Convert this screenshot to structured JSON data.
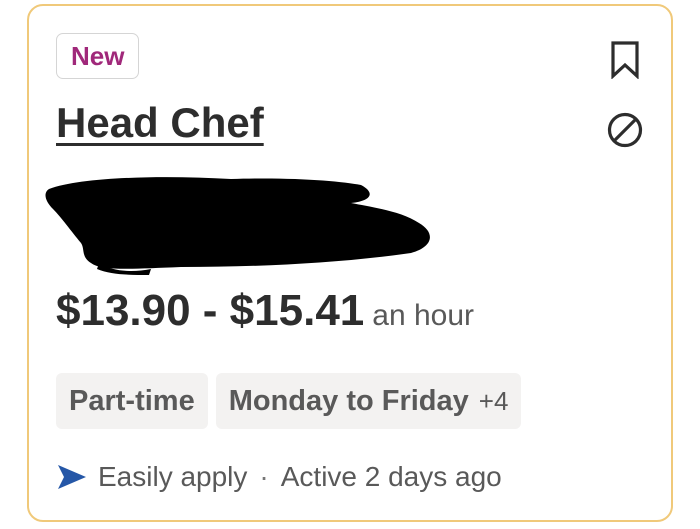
{
  "card": {
    "badge": "New",
    "title": "Head Chef",
    "company_redacted": true,
    "salary": {
      "range": "$13.90 - $15.41",
      "unit": "an hour"
    },
    "tags": [
      {
        "label": "Part-time",
        "extra": ""
      },
      {
        "label": "Monday to Friday",
        "extra": "+4"
      }
    ],
    "footer": {
      "apply": "Easily apply",
      "separator": "·",
      "active": "Active 2 days ago"
    },
    "icons": {
      "save": "bookmark-icon",
      "hide": "not-interested-icon",
      "apply": "send-arrow-icon"
    }
  },
  "colors": {
    "card_border": "#f0c97a",
    "badge_text": "#a0287a",
    "title_text": "#2d2d2d",
    "muted_text": "#595959",
    "tag_bg": "#f3f2f1",
    "apply_icon": "#2557a7"
  }
}
